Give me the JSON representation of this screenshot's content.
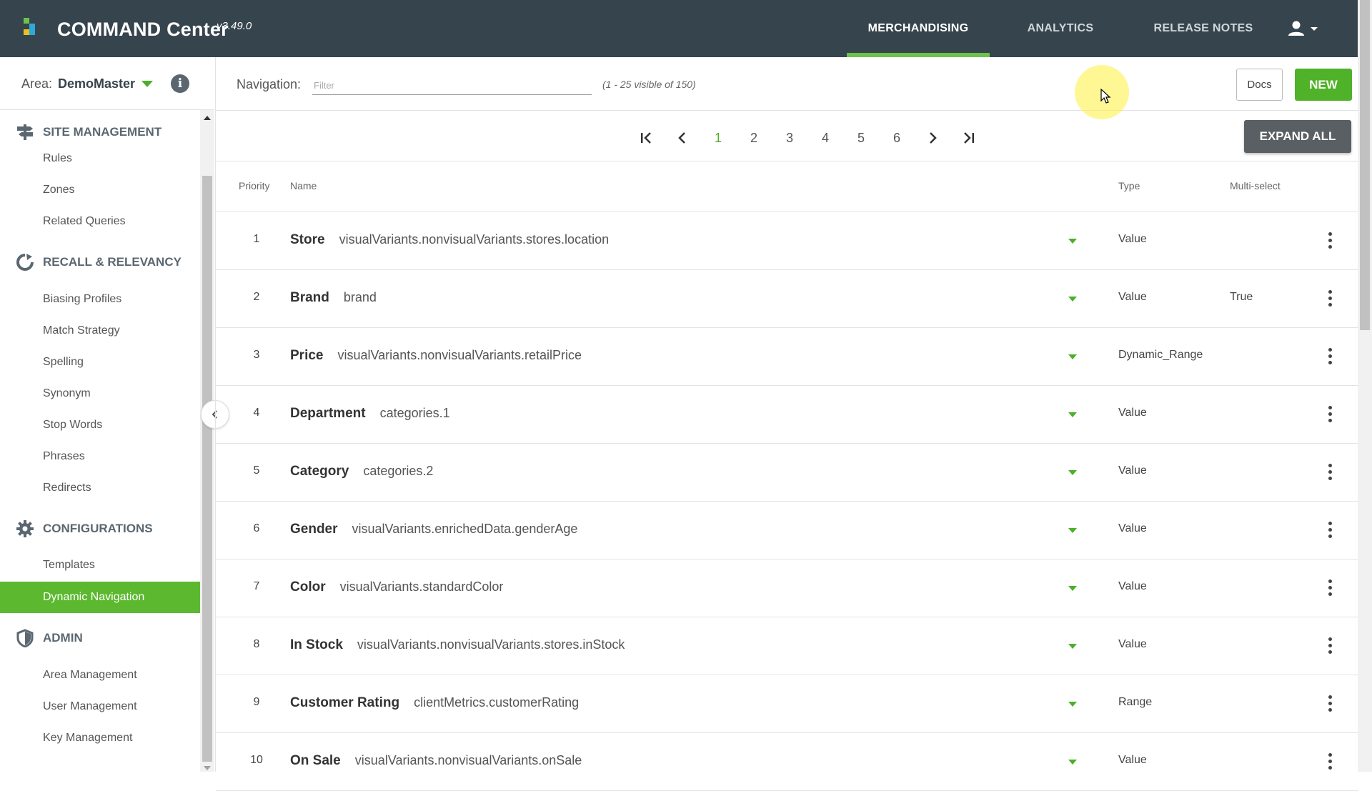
{
  "app": {
    "title": "COMMAND Center",
    "version": "v3.49.0",
    "logo_colors": [
      "#6cc24a",
      "#2ea8d9",
      "#e8c21b"
    ],
    "accent_color": "#6cc24a"
  },
  "topnav": {
    "items": [
      {
        "label": "MERCHANDISING",
        "active": true
      },
      {
        "label": "ANALYTICS",
        "active": false
      },
      {
        "label": "RELEASE NOTES",
        "active": false
      }
    ],
    "user_icon": "account-icon"
  },
  "area": {
    "label": "Area:",
    "value": "DemoMaster",
    "info_icon": "i"
  },
  "sidebar": {
    "sections": [
      {
        "label": "SITE MANAGEMENT",
        "icon": "signpost-icon",
        "items": [
          "Rules",
          "Zones",
          "Related Queries"
        ]
      },
      {
        "label": "RECALL & RELEVANCY",
        "icon": "refresh-circle-icon",
        "items": [
          "Biasing Profiles",
          "Match Strategy",
          "Spelling",
          "Synonym",
          "Stop Words",
          "Phrases",
          "Redirects"
        ]
      },
      {
        "label": "CONFIGURATIONS",
        "icon": "gear-icon",
        "items": [
          "Templates",
          "Dynamic Navigation"
        ]
      },
      {
        "label": "ADMIN",
        "icon": "shield-icon",
        "items": [
          "Area Management",
          "User Management",
          "Key Management"
        ]
      }
    ],
    "active_item": "Dynamic Navigation"
  },
  "toolbar": {
    "navigation_label": "Navigation:",
    "filter_placeholder": "Filter",
    "filter_value": "",
    "visible_count": "(1 - 25 visible of 150)",
    "docs_label": "Docs",
    "new_label": "NEW"
  },
  "pagination": {
    "pages": [
      "1",
      "2",
      "3",
      "4",
      "5",
      "6"
    ],
    "current_page": "1",
    "expand_all_label": "EXPAND ALL"
  },
  "table": {
    "headers": {
      "priority": "Priority",
      "name": "Name",
      "type": "Type",
      "multi": "Multi-select"
    },
    "rows": [
      {
        "priority": "1",
        "title": "Store",
        "field": "visualVariants.nonvisualVariants.stores.location",
        "type": "Value",
        "multi": ""
      },
      {
        "priority": "2",
        "title": "Brand",
        "field": "brand",
        "type": "Value",
        "multi": "True"
      },
      {
        "priority": "3",
        "title": "Price",
        "field": "visualVariants.nonvisualVariants.retailPrice",
        "type": "Dynamic_Range",
        "multi": ""
      },
      {
        "priority": "4",
        "title": "Department",
        "field": "categories.1",
        "type": "Value",
        "multi": ""
      },
      {
        "priority": "5",
        "title": "Category",
        "field": "categories.2",
        "type": "Value",
        "multi": ""
      },
      {
        "priority": "6",
        "title": "Gender",
        "field": "visualVariants.enrichedData.genderAge",
        "type": "Value",
        "multi": ""
      },
      {
        "priority": "7",
        "title": "Color",
        "field": "visualVariants.standardColor",
        "type": "Value",
        "multi": ""
      },
      {
        "priority": "8",
        "title": "In Stock",
        "field": "visualVariants.nonvisualVariants.stores.inStock",
        "type": "Value",
        "multi": ""
      },
      {
        "priority": "9",
        "title": "Customer Rating",
        "field": "clientMetrics.customerRating",
        "type": "Range",
        "multi": ""
      },
      {
        "priority": "10",
        "title": "On Sale",
        "field": "visualVariants.nonvisualVariants.onSale",
        "type": "Value",
        "multi": ""
      }
    ]
  }
}
